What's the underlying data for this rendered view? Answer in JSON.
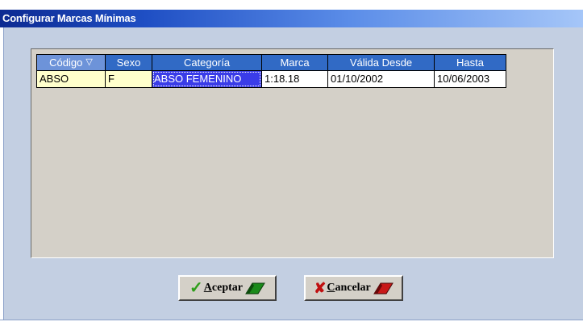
{
  "window": {
    "title": "Configurar Marcas Mínimas"
  },
  "grid": {
    "columns": [
      {
        "label": "Código",
        "sort_icon": "▽"
      },
      {
        "label": "Sexo"
      },
      {
        "label": "Categoría"
      },
      {
        "label": "Marca"
      },
      {
        "label": "Válida Desde"
      },
      {
        "label": "Hasta"
      }
    ],
    "rows": [
      {
        "codigo": "ABSO",
        "sexo": "F",
        "categoria": "ABSO FEMENINO",
        "marca": "1:18.18",
        "valida_desde": "01/10/2002",
        "hasta": "10/06/2003"
      }
    ]
  },
  "buttons": {
    "accept": {
      "prefix": "A",
      "rest": "ceptar",
      "icon": "check-icon",
      "icon_color": "#2e9e1a"
    },
    "cancel": {
      "prefix": "C",
      "rest": "ancelar",
      "icon": "x-icon",
      "icon_color": "#c01010"
    }
  },
  "colors": {
    "header": "#316ac5",
    "selected_cell": "#3a3ce8",
    "key_cell": "#ffffcc",
    "grid_bg": "#d4d0c8",
    "dialog_bg": "#c3cfe2"
  }
}
